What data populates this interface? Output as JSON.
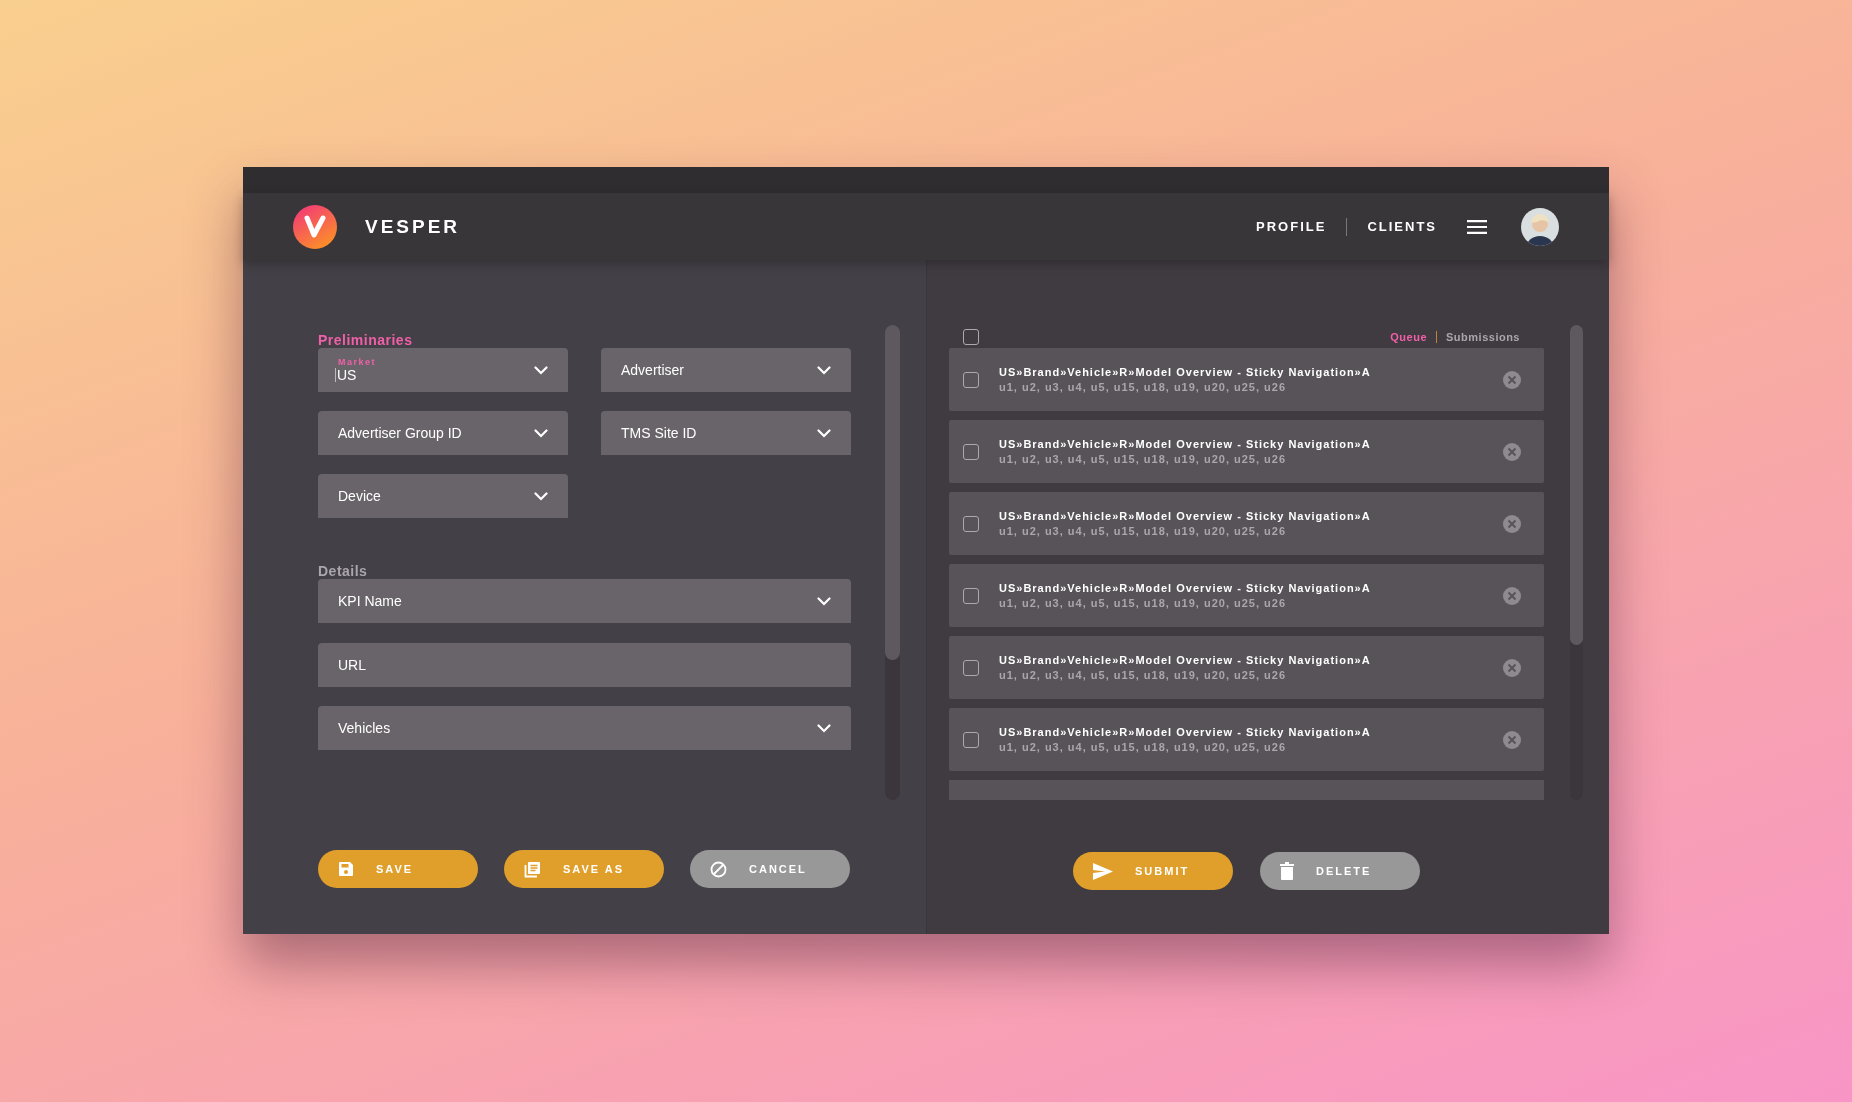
{
  "app": {
    "name": "VESPER"
  },
  "nav": {
    "links": [
      "PROFILE",
      "CLIENTS"
    ]
  },
  "form": {
    "sections": [
      {
        "title": "Preliminaries",
        "active": true,
        "kind": "grid",
        "fields": [
          {
            "kind": "select",
            "label": "Market",
            "value": "US",
            "focused": true
          },
          {
            "kind": "select",
            "placeholder": "Advertiser"
          },
          {
            "kind": "select",
            "placeholder": "Advertiser Group ID"
          },
          {
            "kind": "select",
            "placeholder": "TMS Site ID"
          },
          {
            "kind": "select",
            "placeholder": "Device"
          }
        ]
      },
      {
        "title": "Details",
        "active": false,
        "kind": "stack",
        "fields": [
          {
            "kind": "select",
            "placeholder": "KPI Name"
          },
          {
            "kind": "text",
            "placeholder": "URL"
          },
          {
            "kind": "select",
            "placeholder": "Vehicles"
          }
        ]
      }
    ],
    "buttons": [
      {
        "label": "SAVE",
        "kind": "save"
      },
      {
        "label": "SAVE AS",
        "kind": "save_as"
      },
      {
        "label": "CANCEL",
        "kind": "cancel"
      }
    ]
  },
  "queue": {
    "select_all": {
      "checked": false
    },
    "tabs": [
      {
        "label": "Queue",
        "selected": true
      },
      {
        "label": "Submissions",
        "selected": false
      }
    ],
    "items": [
      {
        "title": "US»Brand»Vehicle»R»Model Overview - Sticky Navigation»A",
        "tags": "u1, u2, u3, u4, u5, u15, u18, u19, u20, u25, u26",
        "checked": false
      },
      {
        "title": "US»Brand»Vehicle»R»Model Overview - Sticky Navigation»A",
        "tags": "u1, u2, u3, u4, u5, u15, u18, u19, u20, u25, u26",
        "checked": false
      },
      {
        "title": "US»Brand»Vehicle»R»Model Overview - Sticky Navigation»A",
        "tags": "u1, u2, u3, u4, u5, u15, u18, u19, u20, u25, u26",
        "checked": false
      },
      {
        "title": "US»Brand»Vehicle»R»Model Overview - Sticky Navigation»A",
        "tags": "u1, u2, u3, u4, u5, u15, u18, u19, u20, u25, u26",
        "checked": false
      },
      {
        "title": "US»Brand»Vehicle»R»Model Overview - Sticky Navigation»A",
        "tags": "u1, u2, u3, u4, u5, u15, u18, u19, u20, u25, u26",
        "checked": false
      },
      {
        "title": "US»Brand»Vehicle»R»Model Overview - Sticky Navigation»A",
        "tags": "u1, u2, u3, u4, u5, u15, u18, u19, u20, u25, u26",
        "checked": false
      }
    ],
    "buttons": [
      {
        "label": "SUBMIT",
        "kind": "submit"
      },
      {
        "label": "DELETE",
        "kind": "delete"
      }
    ]
  }
}
